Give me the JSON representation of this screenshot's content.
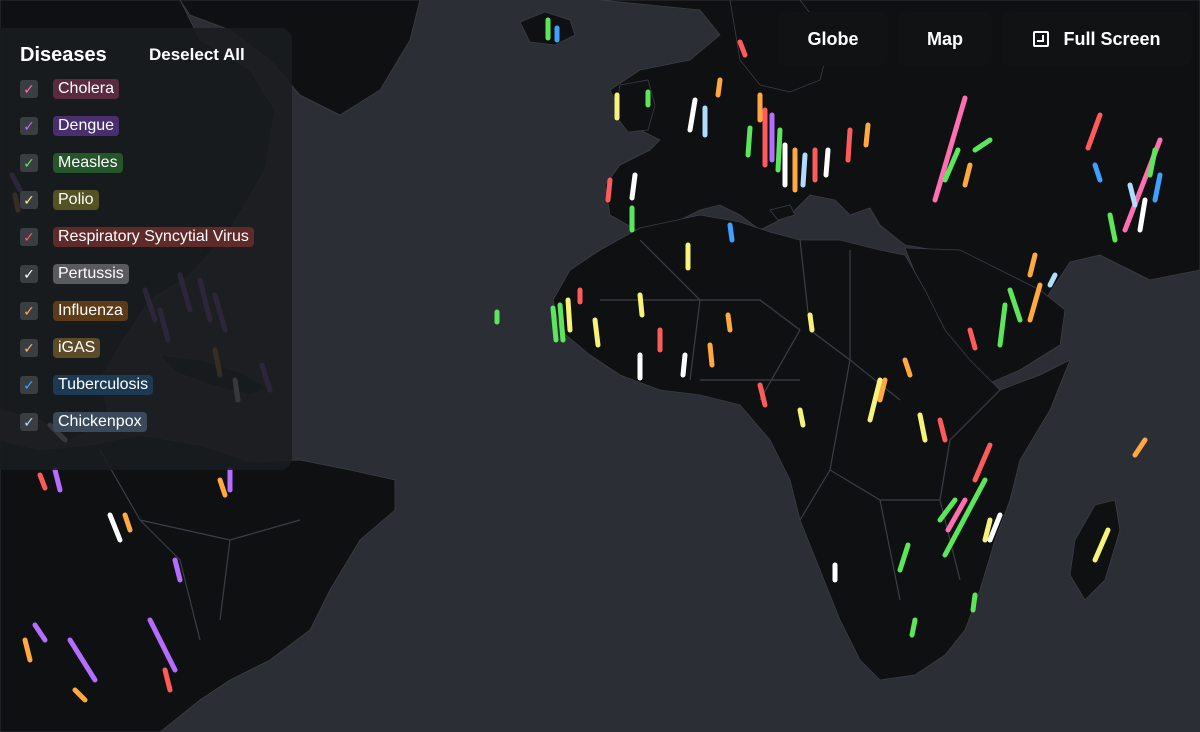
{
  "legend": {
    "title": "Diseases",
    "deselect_label": "Deselect All",
    "items": [
      {
        "label": "Cholera",
        "color": "#ff6fb1",
        "bg": "#5a2b40"
      },
      {
        "label": "Dengue",
        "color": "#b46dff",
        "bg": "#4a2f6f"
      },
      {
        "label": "Measles",
        "color": "#5ce65c",
        "bg": "#25552a"
      },
      {
        "label": "Polio",
        "color": "#f6f27a",
        "bg": "#555226"
      },
      {
        "label": "Respiratory Syncytial Virus",
        "color": "#ff5b5b",
        "bg": "#5e2a2a"
      },
      {
        "label": "Pertussis",
        "color": "#ffffff",
        "bg": "#5a5b60"
      },
      {
        "label": "Influenza",
        "color": "#ffa940",
        "bg": "#5c3b19"
      },
      {
        "label": "iGAS",
        "color": "#ffb86b",
        "bg": "#5c4a28"
      },
      {
        "label": "Tuberculosis",
        "color": "#3fa0ff",
        "bg": "#1d3a55"
      },
      {
        "label": "Chickenpox",
        "color": "#b0dcff",
        "bg": "#3a4a5a"
      }
    ]
  },
  "view": {
    "globe_label": "Globe",
    "map_label": "Map",
    "fullscreen_label": "Full Screen"
  },
  "icons": {
    "checkbox": "check-icon",
    "fullscreen": "fullscreen-icon"
  }
}
